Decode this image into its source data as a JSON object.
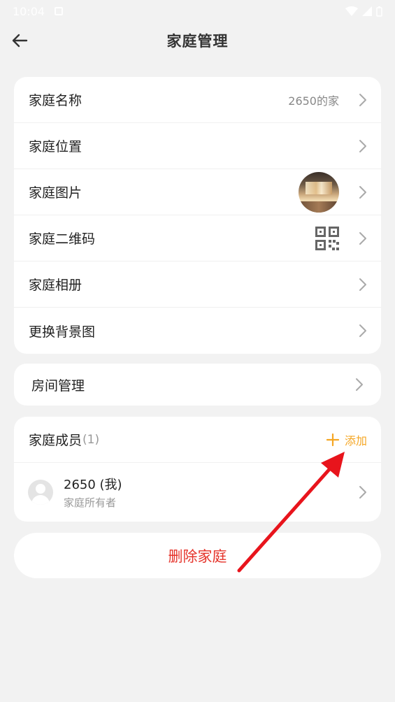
{
  "status_bar": {
    "time": "10:04"
  },
  "header": {
    "title": "家庭管理"
  },
  "settings": {
    "name": {
      "label": "家庭名称",
      "value": "2650的家"
    },
    "location": {
      "label": "家庭位置"
    },
    "image": {
      "label": "家庭图片"
    },
    "qrcode": {
      "label": "家庭二维码"
    },
    "album": {
      "label": "家庭相册"
    },
    "background": {
      "label": "更换背景图"
    }
  },
  "rooms": {
    "label": "房间管理"
  },
  "members": {
    "label": "家庭成员",
    "count": "(1)",
    "add_label": "添加",
    "list": [
      {
        "name": "2650 (我)",
        "role": "家庭所有者"
      }
    ]
  },
  "delete": {
    "label": "删除家庭"
  },
  "colors": {
    "accent": "#f5a623",
    "danger": "#e5332a",
    "annotation": "#e8141c"
  }
}
